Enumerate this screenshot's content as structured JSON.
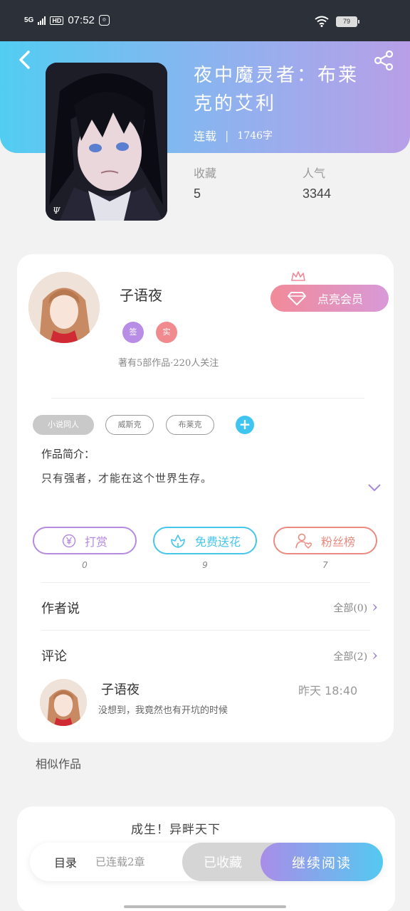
{
  "status_bar": {
    "network": "5G",
    "hd": "HD",
    "time": "07:52",
    "battery": "79"
  },
  "book": {
    "title": "夜中魔灵者：布莱克的艾利",
    "status": "连载",
    "word_count": "1746字",
    "stats": [
      {
        "label": "收藏",
        "value": "5"
      },
      {
        "label": "人气",
        "value": "3344"
      }
    ]
  },
  "author": {
    "name": "子语夜",
    "badges": [
      {
        "text": "签",
        "color": "#b88de6"
      },
      {
        "text": "实",
        "color": "#f08a8e"
      }
    ],
    "stats_text": "著有5部作品·220人关注",
    "vip_button": "点亮会员"
  },
  "tags": [
    "小说同人",
    "威斯克",
    "布莱克"
  ],
  "intro": {
    "label": "作品简介：",
    "text": "只有强者，才能在这个世界生存。"
  },
  "actions": [
    {
      "label": "打赏",
      "count": "0",
      "color": "#b58be0"
    },
    {
      "label": "免费送花",
      "count": "9",
      "color": "#45c6ea"
    },
    {
      "label": "粉丝榜",
      "count": "7",
      "color": "#ea8a80"
    }
  ],
  "author_says": {
    "label": "作者说",
    "link": "全部(0)"
  },
  "comments": {
    "label": "评论",
    "link": "全部(2)",
    "items": [
      {
        "name": "子语夜",
        "time": "昨天 18:40",
        "text": "没想到，我竟然也有开坑的时候"
      }
    ]
  },
  "similar": {
    "label": "相似作品",
    "first_title": "成生！异畔天下"
  },
  "bottom_bar": {
    "toc": "目录",
    "status": "已连载2章",
    "collected": "已收藏",
    "continue": "继续阅读"
  }
}
